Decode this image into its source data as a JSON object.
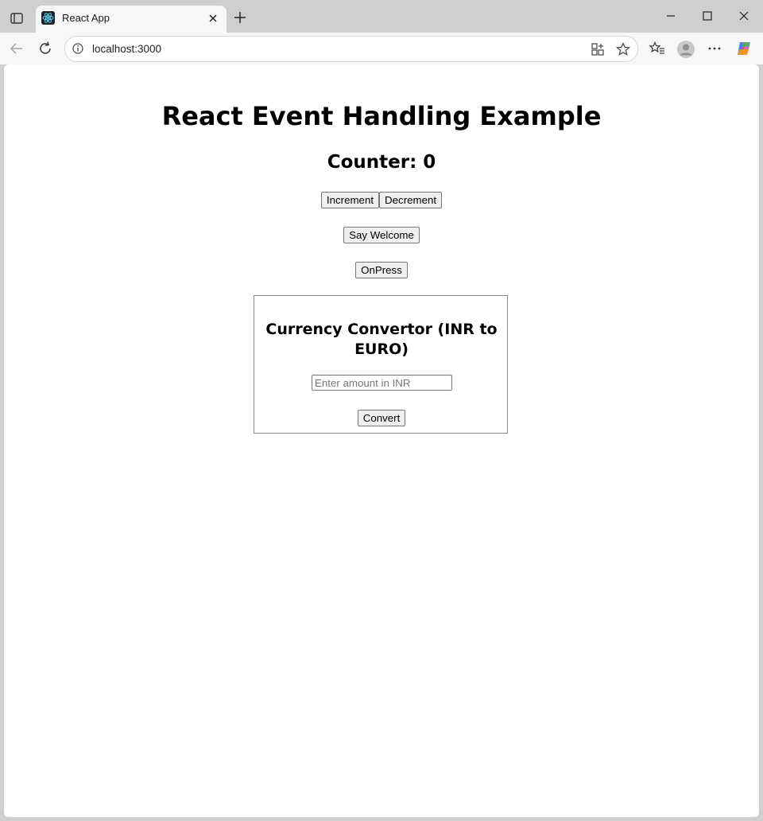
{
  "browser": {
    "tab_title": "React App",
    "url": "localhost:3000"
  },
  "page": {
    "title": "React Event Handling Example",
    "counter_text": "Counter: 0",
    "increment_label": "Increment",
    "decrement_label": "Decrement",
    "welcome_label": "Say Welcome",
    "onpress_label": "OnPress"
  },
  "currency": {
    "heading": "Currency Convertor (INR to EURO)",
    "input_value": "",
    "input_placeholder": "Enter amount in INR",
    "convert_label": "Convert"
  }
}
